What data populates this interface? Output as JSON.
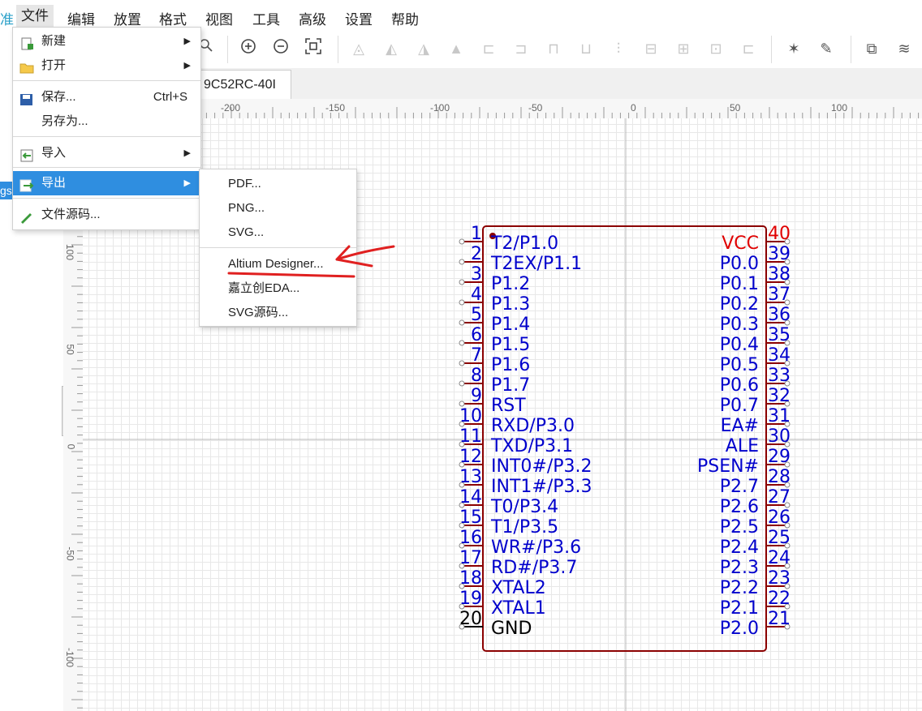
{
  "menubar": {
    "partial_left": "准",
    "items": [
      "文件",
      "编辑",
      "放置",
      "格式",
      "视图",
      "工具",
      "高级",
      "设置",
      "帮助"
    ],
    "active": "文件"
  },
  "left_panel": {
    "partial_text": "gs"
  },
  "tab": {
    "title": "9C52RC-40I"
  },
  "ruler": {
    "h_labels": [
      "-200",
      "-150",
      "-100",
      "-50",
      "0",
      "50",
      "100"
    ],
    "v_labels": [
      "100",
      "50",
      "0",
      "-50",
      "-100"
    ]
  },
  "file_menu": {
    "items": [
      {
        "label": "新建",
        "icon": "new-file-icon",
        "submenu": true
      },
      {
        "label": "打开",
        "icon": "folder-open-icon",
        "submenu": true
      },
      {
        "label": "保存...",
        "icon": "save-icon",
        "shortcut": "Ctrl+S"
      },
      {
        "label": "另存为...",
        "icon": ""
      },
      {
        "label": "导入",
        "icon": "import-icon",
        "submenu": true
      },
      {
        "label": "导出",
        "icon": "export-icon",
        "submenu": true,
        "highlighted": true
      },
      {
        "label": "文件源码...",
        "icon": "pencil-icon"
      }
    ]
  },
  "export_submenu": {
    "items": [
      "PDF...",
      "PNG...",
      "SVG...",
      "Altium Designer...",
      "嘉立创EDA...",
      "SVG源码..."
    ],
    "marked": "Altium Designer..."
  },
  "chip": {
    "left_pins": [
      {
        "num": "1",
        "name": "T2/P1.0"
      },
      {
        "num": "2",
        "name": "T2EX/P1.1"
      },
      {
        "num": "3",
        "name": "P1.2"
      },
      {
        "num": "4",
        "name": "P1.3"
      },
      {
        "num": "5",
        "name": "P1.4"
      },
      {
        "num": "6",
        "name": "P1.5"
      },
      {
        "num": "7",
        "name": "P1.6"
      },
      {
        "num": "8",
        "name": "P1.7"
      },
      {
        "num": "9",
        "name": "RST"
      },
      {
        "num": "10",
        "name": "RXD/P3.0"
      },
      {
        "num": "11",
        "name": "TXD/P3.1"
      },
      {
        "num": "12",
        "name": "INT0#/P3.2"
      },
      {
        "num": "13",
        "name": "INT1#/P3.3"
      },
      {
        "num": "14",
        "name": "T0/P3.4"
      },
      {
        "num": "15",
        "name": "T1/P3.5"
      },
      {
        "num": "16",
        "name": "WR#/P3.6"
      },
      {
        "num": "17",
        "name": "RD#/P3.7"
      },
      {
        "num": "18",
        "name": "XTAL2"
      },
      {
        "num": "19",
        "name": "XTAL1"
      },
      {
        "num": "20",
        "name": "GND"
      }
    ],
    "right_pins": [
      {
        "num": "40",
        "name": "VCC"
      },
      {
        "num": "39",
        "name": "P0.0"
      },
      {
        "num": "38",
        "name": "P0.1"
      },
      {
        "num": "37",
        "name": "P0.2"
      },
      {
        "num": "36",
        "name": "P0.3"
      },
      {
        "num": "35",
        "name": "P0.4"
      },
      {
        "num": "34",
        "name": "P0.5"
      },
      {
        "num": "33",
        "name": "P0.6"
      },
      {
        "num": "32",
        "name": "P0.7"
      },
      {
        "num": "31",
        "name": "EA#"
      },
      {
        "num": "30",
        "name": "ALE"
      },
      {
        "num": "29",
        "name": "PSEN#"
      },
      {
        "num": "28",
        "name": "P2.7"
      },
      {
        "num": "27",
        "name": "P2.6"
      },
      {
        "num": "26",
        "name": "P2.5"
      },
      {
        "num": "25",
        "name": "P2.4"
      },
      {
        "num": "24",
        "name": "P2.3"
      },
      {
        "num": "23",
        "name": "P2.2"
      },
      {
        "num": "22",
        "name": "P2.1"
      },
      {
        "num": "21",
        "name": "P2.0"
      }
    ],
    "colors": {
      "body": "#8b0000",
      "pin_text": "#0000cc",
      "power_text": "#e00000",
      "ground_text": "#000000"
    }
  },
  "colors": {
    "menu_highlight": "#2f8ee0",
    "annotation": "#e02020"
  }
}
